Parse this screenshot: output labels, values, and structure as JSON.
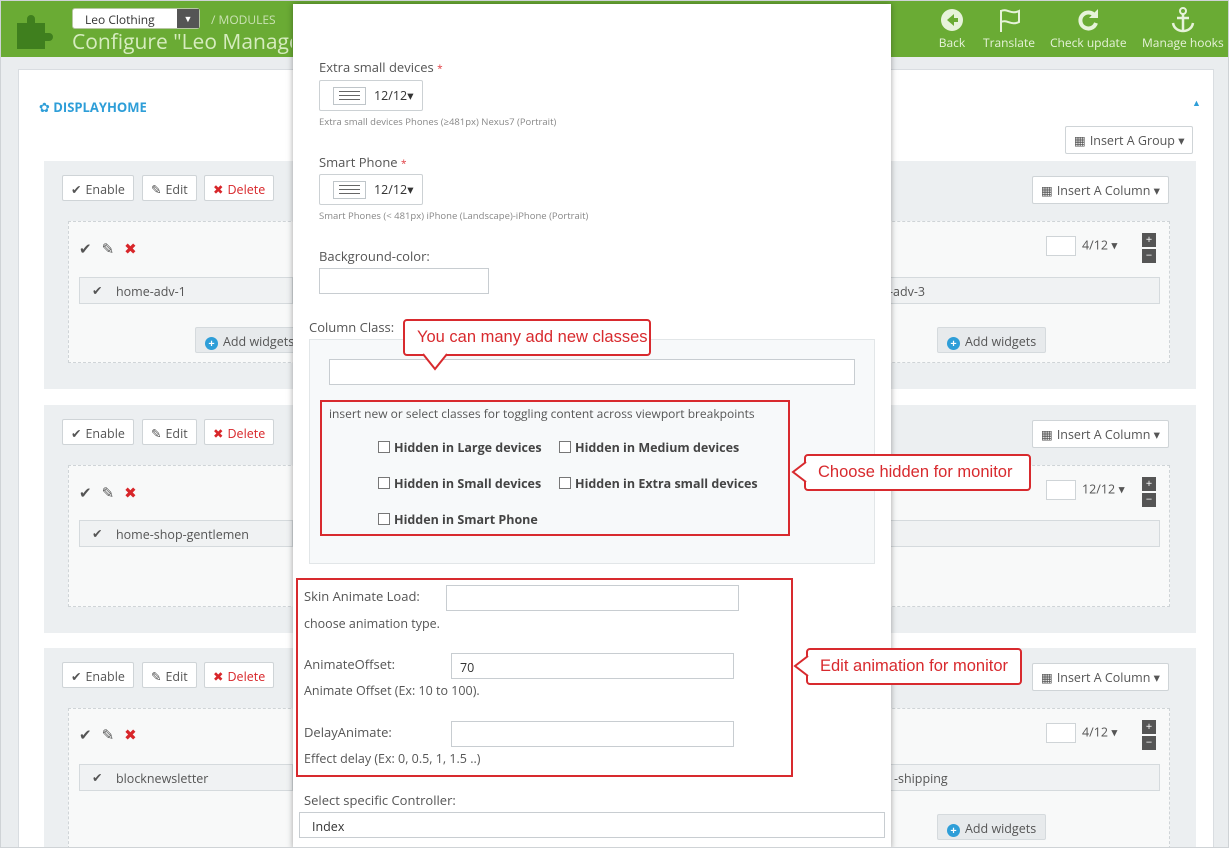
{
  "header": {
    "shop_name": "Leo Clothing",
    "breadcrumb": "MODULES",
    "title": "Configure \"Leo Manage W",
    "toolbar": [
      {
        "label": "Back",
        "icon": "back-icon"
      },
      {
        "label": "Translate",
        "icon": "flag-icon"
      },
      {
        "label": "Check update",
        "icon": "refresh-icon"
      },
      {
        "label": "Manage hooks",
        "icon": "anchor-icon"
      }
    ]
  },
  "background": {
    "section_title": "DISPLAYHOME",
    "insert_group_label": "Insert A Group",
    "insert_column_label": "Insert A Column",
    "enable_label": "Enable",
    "edit_label": "Edit",
    "delete_label": "Delete",
    "add_widgets_label": "Add widgets",
    "groups": [
      {
        "module_left": "home-adv-1",
        "module_right": "-adv-3",
        "width_right": "4/12"
      },
      {
        "module_left": "home-shop-gentlemen",
        "width_right": "12/12"
      },
      {
        "module_left": "blocknewsletter",
        "module_right": "-shipping",
        "width_right": "4/12"
      }
    ]
  },
  "modal": {
    "xs_label": "Extra small devices",
    "xs_value": "12/12",
    "xs_hint": "Extra small devices Phones (≥481px) Nexus7 (Portrait)",
    "sp_label": "Smart Phone",
    "sp_value": "12/12",
    "sp_hint": "Smart Phones (< 481px) iPhone (Landscape)-iPhone (Portrait)",
    "bg_label": "Background-color:",
    "bg_value": "",
    "column_class_label": "Column Class:",
    "column_class_value": "",
    "class_help": "insert new or select classes for toggling content across viewport breakpoints",
    "checkboxes": [
      "Hidden in Large devices",
      "Hidden in Medium devices",
      "Hidden in Small devices",
      "Hidden in Extra small devices",
      "Hidden in Smart Phone"
    ],
    "skin_label": "Skin Animate Load:",
    "skin_value": "",
    "skin_help": "choose animation type.",
    "offset_label": "AnimateOffset:",
    "offset_value": "70",
    "offset_help": "Animate Offset (Ex: 10 to 100).",
    "delay_label": "DelayAnimate:",
    "delay_value": "",
    "delay_help": "Effect delay (Ex: 0, 0.5, 1, 1.5 ..)",
    "controller_label": "Select specific Controller:",
    "controller_value": "Index"
  },
  "annotations": {
    "classes": "You can many add new classes",
    "hidden": "Choose hidden for monitor",
    "animation": "Edit animation for monitor"
  },
  "colors": {
    "header_green": "#6aab34",
    "accent_blue": "#2e9ed8",
    "annotation_red": "#d82a2e"
  }
}
